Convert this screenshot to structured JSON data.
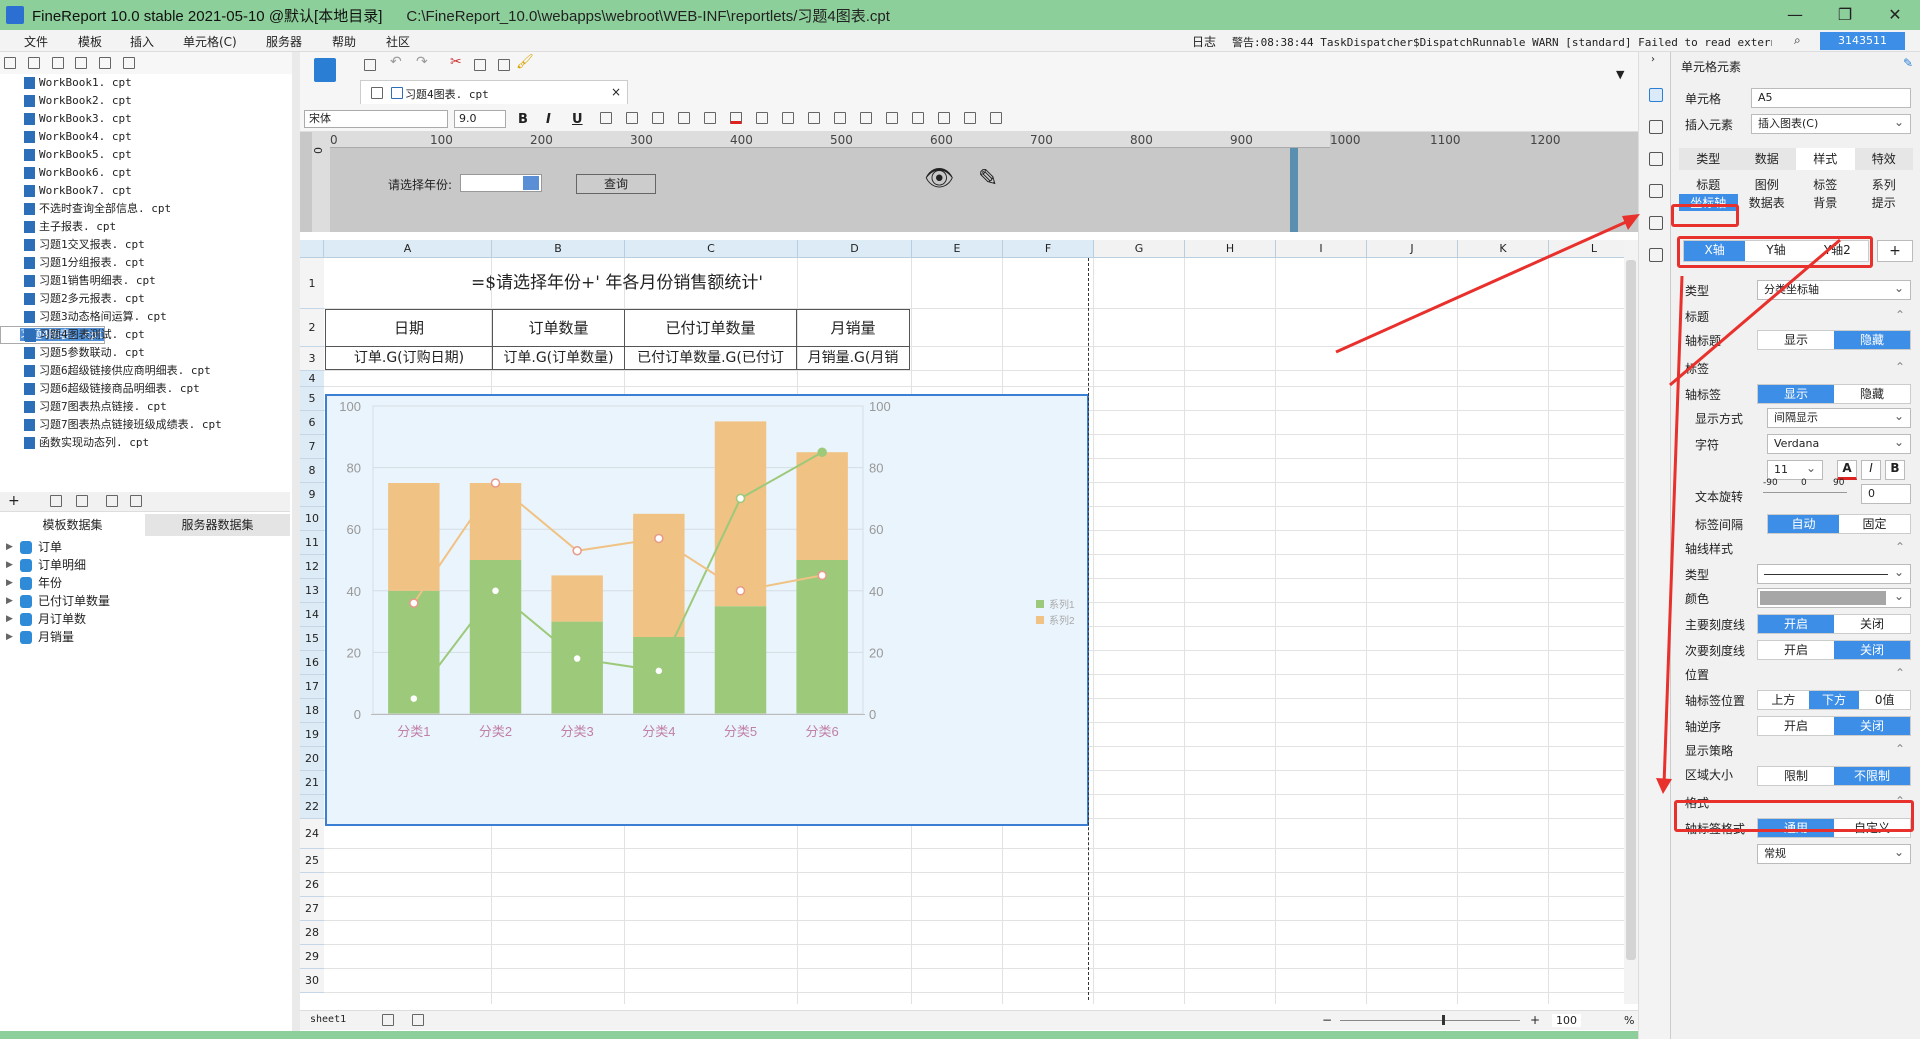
{
  "window": {
    "app": "FineReport 10.0 stable 2021-05-10 @默认[本地目录]",
    "path": "C:\\FineReport_10.0\\webapps\\webroot\\WEB-INF\\reportlets/习题4图表.cpt",
    "minimize": "—",
    "maximize": "❐",
    "close": "✕"
  },
  "menu": {
    "items": [
      "文件",
      "模板",
      "插入",
      "单元格(C)",
      "服务器",
      "帮助",
      "社区"
    ],
    "log_label": "日志",
    "log_text": "警告:08:38:44 TaskDispatcher$DispatchRunnable WARN [standard] Failed to read external conf...",
    "user": "3143511"
  },
  "files": [
    "WorkBook1. cpt",
    "WorkBook2. cpt",
    "WorkBook3. cpt",
    "WorkBook4. cpt",
    "WorkBook5. cpt",
    "WorkBook6. cpt",
    "WorkBook7. cpt",
    "不选时查询全部信息. cpt",
    "主子报表. cpt",
    "习题1交叉报表. cpt",
    "习题1分组报表. cpt",
    "习题1销售明细表. cpt",
    "习题2多元报表. cpt",
    "习题3动态格间运算. cpt",
    "习题4图表. cpt",
    "习题4图表测试. cpt",
    "习题5参数联动. cpt",
    "习题6超级链接供应商明细表. cpt",
    "习题6超级链接商品明细表. cpt",
    "习题7图表热点链接. cpt",
    "习题7图表热点链接班级成绩表. cpt",
    "函数实现动态列. cpt"
  ],
  "datasets": {
    "tab1": "模板数据集",
    "tab2": "服务器数据集",
    "items": [
      "订单",
      "订单明细",
      "年份",
      "已付订单数量",
      "月订单数",
      "月销量"
    ]
  },
  "editor": {
    "tab": "习题4图表. cpt",
    "font": "宋体",
    "size": "9.0",
    "bold": "B",
    "italic": "I",
    "underline": "U",
    "param_label": "请选择年份:",
    "query": "查询"
  },
  "ruler": [
    "0",
    "100",
    "200",
    "300",
    "400",
    "500",
    "600",
    "700",
    "800",
    "900",
    "1000",
    "1100",
    "1200"
  ],
  "ruler_v": "0",
  "grid": {
    "cols": [
      "A",
      "B",
      "C",
      "D",
      "E",
      "F",
      "G",
      "H",
      "I",
      "J",
      "K",
      "L"
    ],
    "rows": [
      "1",
      "2",
      "3",
      "4",
      "5",
      "6",
      "7",
      "8",
      "9",
      "10",
      "11",
      "12",
      "13",
      "14",
      "15",
      "16",
      "17",
      "18",
      "19",
      "20",
      "21",
      "22",
      "24",
      "25",
      "26",
      "27",
      "28",
      "29",
      "30"
    ],
    "formula": "=$请选择年份+' 年各月份销售额统计'",
    "headers": [
      "日期",
      "订单数量",
      "已付订单数量",
      "月销量"
    ],
    "row3": [
      "订单.G(订购日期)",
      "订单.G(订单数量)",
      "已付订单数量.G(已付订",
      "月销量.G(月销"
    ]
  },
  "chart_data": {
    "type": "bar",
    "categories": [
      "分类1",
      "分类2",
      "分类3",
      "分类4",
      "分类5",
      "分类6"
    ],
    "series": [
      {
        "name": "系列1",
        "type": "stacked-bar",
        "color": "#9cc97a",
        "values": [
          40,
          50,
          30,
          25,
          35,
          50
        ]
      },
      {
        "name": "系列2",
        "type": "stacked-bar",
        "color": "#f0c283",
        "values": [
          35,
          25,
          15,
          40,
          60,
          35
        ]
      },
      {
        "name": "",
        "type": "line",
        "color": "#9cc97a",
        "values": [
          5,
          40,
          18,
          14,
          70,
          85
        ]
      },
      {
        "name": "",
        "type": "line",
        "color": "#f0c283",
        "values": [
          36,
          75,
          53,
          57,
          40,
          45
        ]
      }
    ],
    "yticks": [
      "0",
      "20",
      "40",
      "60",
      "80",
      "100"
    ],
    "ylim": [
      0,
      100
    ],
    "legend": "right",
    "grid": true
  },
  "status": {
    "sheet": "sheet1",
    "zoom": "100",
    "pct": "%"
  },
  "panel": {
    "title": "单元格元素",
    "cell_label": "单元格",
    "cell_value": "A5",
    "insert_label": "插入元素",
    "insert_value": "插入图表(C)",
    "tabs": [
      "类型",
      "数据",
      "样式",
      "特效"
    ],
    "sub1": [
      "标题",
      "图例",
      "标签",
      "系列"
    ],
    "sub2": [
      "坐标轴",
      "数据表",
      "背景",
      "提示"
    ],
    "axes": [
      "X轴",
      "Y轴",
      "Y轴2"
    ],
    "type_label": "类型",
    "type_value": "分类坐标轴",
    "title_sec": "标题",
    "axis_title": "轴标题",
    "show": "显示",
    "hide": "隐藏",
    "label_sec": "标签",
    "axis_label": "轴标签",
    "display_mode": "显示方式",
    "display_value": "间隔显示",
    "font_label": "字符",
    "font_value": "Verdana",
    "font_size": "11",
    "rot_label": "文本旋转",
    "rot_min": "-90",
    "rot_mid": "0",
    "rot_max": "90",
    "rot_value": "0",
    "interval_label": "标签间隔",
    "auto": "自动",
    "fixed": "固定",
    "linestyle_sec": "轴线样式",
    "line_type": "类型",
    "color_label": "颜色",
    "major": "主要刻度线",
    "minor": "次要刻度线",
    "on": "开启",
    "off": "关闭",
    "pos_sec": "位置",
    "label_pos": "轴标签位置",
    "above": "上方",
    "below": "下方",
    "zero": "0值",
    "reverse": "轴逆序",
    "strategy_sec": "显示策略",
    "area_label": "区域大小",
    "limit": "限制",
    "nolimit": "不限制",
    "format_sec": "格式",
    "label_format": "轴标签格式",
    "general": "通用",
    "custom": "自定义",
    "format_value": "常规"
  }
}
